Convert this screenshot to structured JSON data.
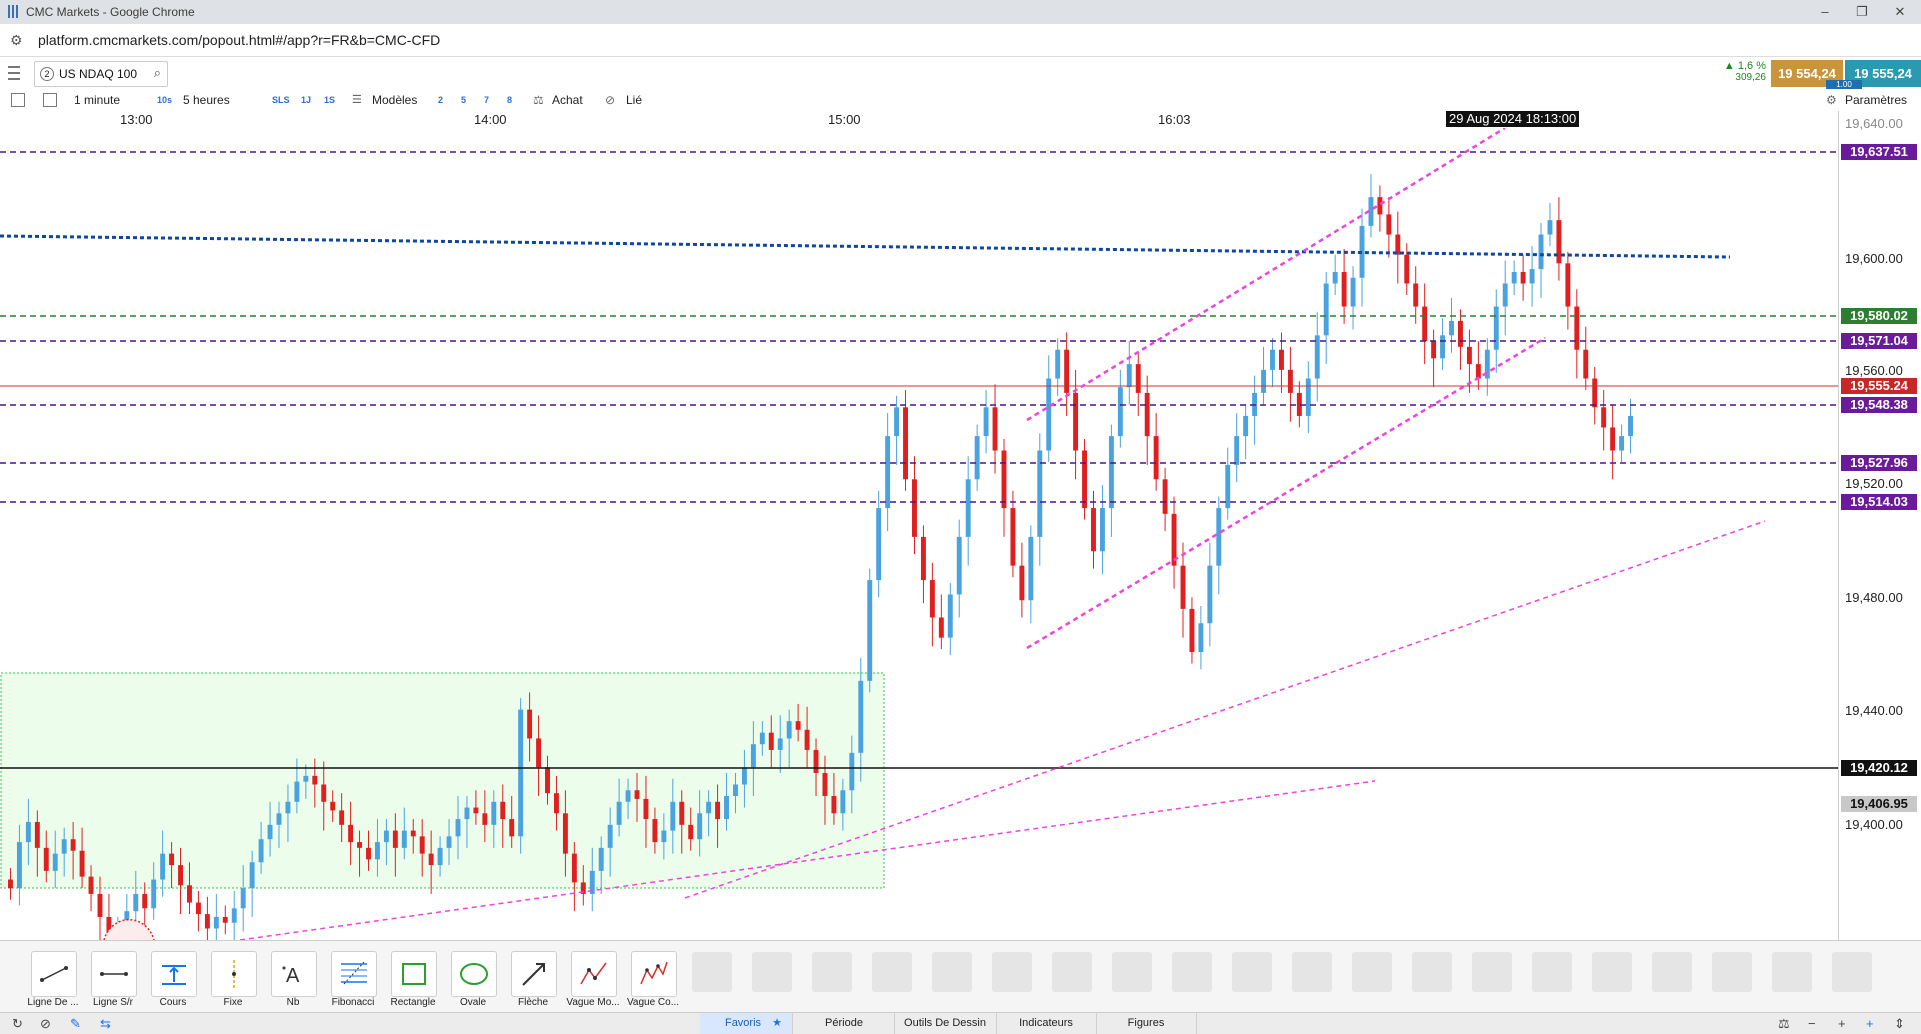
{
  "window": {
    "title": "CMC Markets - Google Chrome",
    "controls": [
      "–",
      "❐",
      "✕"
    ]
  },
  "address": {
    "url": "platform.cmcmarkets.com/popout.html#/app?r=FR&b=CMC-CFD"
  },
  "instrument": {
    "index": "2",
    "name": "US NDAQ 100"
  },
  "quote": {
    "change_pct": "▲ 1,6 %",
    "change_pts": "309,26",
    "sell": "19 554,24",
    "buy": "19 555,24",
    "spread": "1.00"
  },
  "toolbar": {
    "interval": "1 minute",
    "s10": "10s",
    "period": "5 heures",
    "sls": "SLS",
    "j1": "1J",
    "s1": "1S",
    "modeles": "Modèles",
    "n2": "2",
    "n5": "5",
    "n7": "7",
    "n8": "8",
    "achat": "Achat",
    "lie": "Lié",
    "parametres": "Paramètres"
  },
  "time_axis": {
    "labels": [
      "13:00",
      "14:00",
      "15:00",
      "16:03"
    ],
    "cursor": "29 Aug 2024 18:13:00"
  },
  "price_axis": {
    "labels": [
      "19,600.00",
      "19,560.00",
      "19,520.00",
      "19,480.00",
      "19,440.00",
      "19,400.00"
    ],
    "partial_top": "19,640.00"
  },
  "price_tags": [
    {
      "text": "19,637.51",
      "color": "#6a1b9a"
    },
    {
      "text": "19,580.02",
      "color": "#2e7d32"
    },
    {
      "text": "19,571.04",
      "color": "#6a1b9a"
    },
    {
      "text": "19,555.24",
      "color": "#c62828"
    },
    {
      "text": "19,548.38",
      "color": "#6a1b9a"
    },
    {
      "text": "19,527.96",
      "color": "#6a1b9a"
    },
    {
      "text": "19,514.03",
      "color": "#6a1b9a"
    },
    {
      "text": "19,420.12",
      "color": "#111111"
    },
    {
      "text": "19,406.95",
      "color": "#c8c8c8"
    }
  ],
  "tools": [
    {
      "label": "Ligne De ...",
      "icon": "line-tool-icon"
    },
    {
      "label": "Ligne S/r",
      "icon": "sr-line-icon"
    },
    {
      "label": "Cours",
      "icon": "price-line-icon"
    },
    {
      "label": "Fixe",
      "icon": "fixed-line-icon"
    },
    {
      "label": "Nb",
      "icon": "note-icon"
    },
    {
      "label": "Fibonacci",
      "icon": "fibonacci-icon"
    },
    {
      "label": "Rectangle",
      "icon": "rectangle-icon"
    },
    {
      "label": "Ovale",
      "icon": "oval-icon"
    },
    {
      "label": "Flèche",
      "icon": "arrow-icon"
    },
    {
      "label": "Vague Mo...",
      "icon": "wave-icon"
    },
    {
      "label": "Vague Co...",
      "icon": "wave2-icon"
    }
  ],
  "tabs": {
    "favoris": "Favoris",
    "periode": "Période",
    "outils": "Outils De Dessin",
    "indicateurs": "Indicateurs",
    "figures": "Figures"
  },
  "colors": {
    "bull": "#4aa3df",
    "bear": "#e02020",
    "trend": "#ee44dd",
    "level": "#4a148c",
    "zone": "#e9fbe9"
  },
  "chart_data": {
    "type": "candlestick",
    "symbol": "US NDAQ 100",
    "interval": "1 minute",
    "y_range": [
      19370,
      19652
    ],
    "closes": [
      19388,
      19404,
      19411,
      19402,
      19394,
      19400,
      19405,
      19401,
      19392,
      19386,
      19378,
      19371,
      19374,
      19380,
      19386,
      19381,
      19391,
      19400,
      19396,
      19389,
      19383,
      19379,
      19374,
      19378,
      19376,
      19381,
      19388,
      19397,
      19405,
      19410,
      19414,
      19418,
      19425,
      19427,
      19424,
      19418,
      19415,
      19410,
      19404,
      19402,
      19398,
      19404,
      19408,
      19402,
      19408,
      19406,
      19400,
      19396,
      19402,
      19406,
      19412,
      19416,
      19414,
      19410,
      19418,
      19412,
      19406,
      19450,
      19440,
      19430,
      19421,
      19414,
      19400,
      19390,
      19386,
      19394,
      19402,
      19410,
      19418,
      19422,
      19419,
      19412,
      19404,
      19408,
      19418,
      19410,
      19405,
      19414,
      19418,
      19412,
      19420,
      19424,
      19430,
      19438,
      19442,
      19436,
      19440,
      19446,
      19443,
      19436,
      19428,
      19420,
      19414,
      19422,
      19435,
      19460,
      19495,
      19520,
      19545,
      19555,
      19530,
      19510,
      19495,
      19482,
      19475,
      19490,
      19510,
      19530,
      19545,
      19555,
      19540,
      19520,
      19500,
      19488,
      19510,
      19540,
      19565,
      19575,
      19560,
      19540,
      19520,
      19505,
      19520,
      19545,
      19562,
      19570,
      19560,
      19545,
      19530,
      19518,
      19500,
      19485,
      19470,
      19480,
      19500,
      19520,
      19535,
      19545,
      19552,
      19560,
      19568,
      19575,
      19568,
      19560,
      19552,
      19565,
      19580,
      19598,
      19602,
      19590,
      19600,
      19618,
      19628,
      19622,
      19615,
      19608,
      19598,
      19590,
      19578,
      19572,
      19580,
      19585,
      19576,
      19570,
      19565,
      19575,
      19590,
      19598,
      19602,
      19598,
      19603,
      19615,
      19620,
      19605,
      19590,
      19575,
      19565,
      19555,
      19548,
      19540,
      19545,
      19552
    ]
  }
}
